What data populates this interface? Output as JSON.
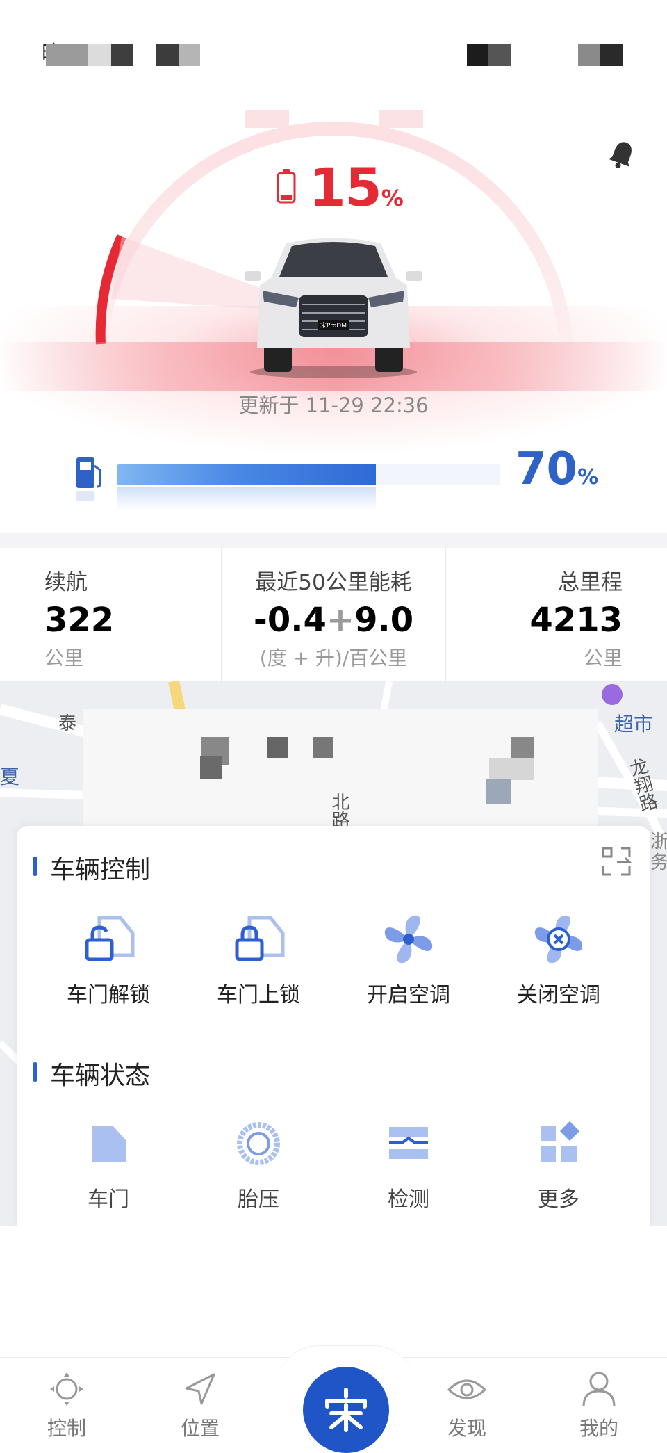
{
  "status_bar": {
    "time": "晚"
  },
  "battery": {
    "value": "15",
    "unit": "%"
  },
  "update_text": "更新于 11-29 22:36",
  "fuel": {
    "value": "70",
    "unit": "%",
    "level": 0.7
  },
  "stats": {
    "range": {
      "label": "续航",
      "value": "322",
      "unit": "公里"
    },
    "consumption": {
      "label": "最近50公里能耗",
      "value_a": "-0.4",
      "plus": "+",
      "value_b": "9.0",
      "unit": "(度 + 升)/百公里"
    },
    "mileage": {
      "label": "总里程",
      "value": "4213",
      "unit": "公里"
    }
  },
  "map": {
    "labels": [
      "超市",
      "龙翔路",
      "北路",
      "夏",
      "泰",
      "浙",
      "务"
    ]
  },
  "vehicle_control": {
    "title": "车辆控制",
    "items": [
      {
        "label": "车门解锁",
        "icon": "door-unlock-icon"
      },
      {
        "label": "车门上锁",
        "icon": "door-lock-icon"
      },
      {
        "label": "开启空调",
        "icon": "ac-on-icon"
      },
      {
        "label": "关闭空调",
        "icon": "ac-off-icon"
      }
    ]
  },
  "vehicle_status": {
    "title": "车辆状态",
    "items": [
      {
        "label": "车门",
        "icon": "door-icon"
      },
      {
        "label": "胎压",
        "icon": "tire-icon"
      },
      {
        "label": "检测",
        "icon": "inspection-icon"
      },
      {
        "label": "更多",
        "icon": "more-icon"
      }
    ]
  },
  "nav": {
    "items": [
      {
        "label": "控制",
        "icon": "control-icon"
      },
      {
        "label": "位置",
        "icon": "location-icon"
      },
      {
        "label": "",
        "icon": "brand-logo-icon"
      },
      {
        "label": "发现",
        "icon": "discover-icon"
      },
      {
        "label": "我的",
        "icon": "profile-icon"
      }
    ]
  },
  "colors": {
    "accent_blue": "#2e5fd0",
    "battery_red": "#e52a35",
    "icon_blue": "#6d8fe0"
  }
}
